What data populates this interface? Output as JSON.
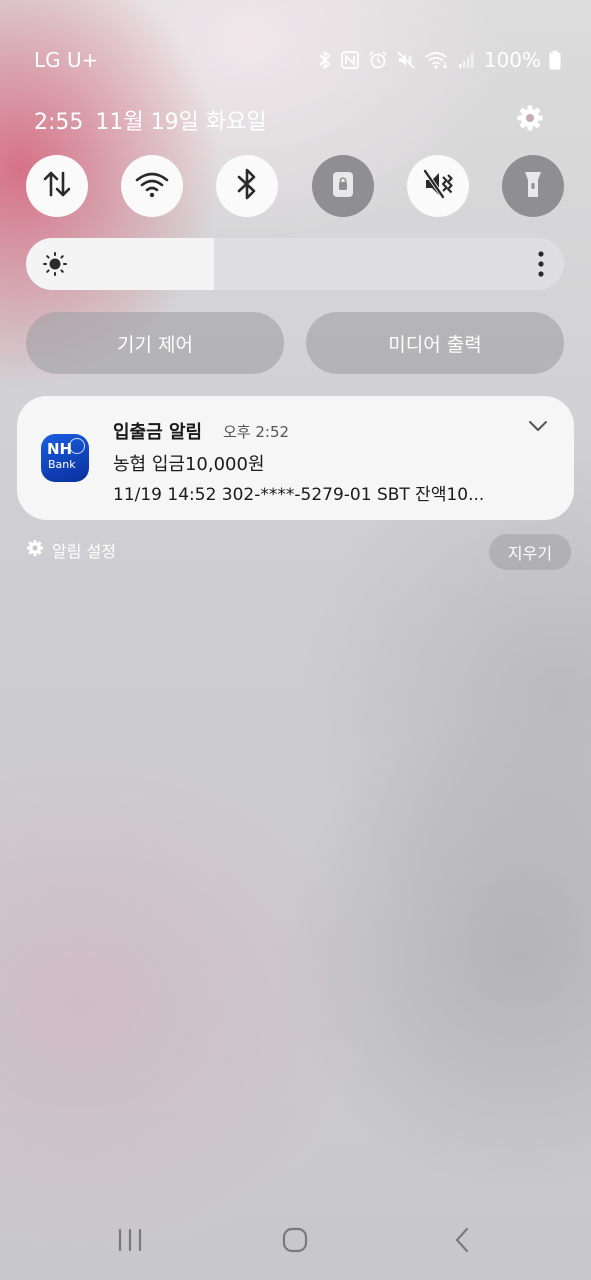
{
  "status_bar": {
    "carrier": "LG U+",
    "battery": "100%",
    "icons": [
      "bluetooth-icon",
      "nfc-icon",
      "alarm-icon",
      "vibrate-mute-icon",
      "wifi-icon",
      "signal-icon",
      "battery-icon"
    ]
  },
  "header": {
    "time": "2:55",
    "date": "11월 19일 화요일",
    "settings_icon": "gear-icon"
  },
  "quick_settings": {
    "tiles": [
      {
        "name": "mobile-data",
        "icon": "data-arrows-icon",
        "active": true
      },
      {
        "name": "wifi",
        "icon": "wifi-icon",
        "active": true
      },
      {
        "name": "bluetooth",
        "icon": "bluetooth-icon",
        "active": true
      },
      {
        "name": "screen-lock",
        "icon": "lock-icon",
        "active": false
      },
      {
        "name": "sound",
        "icon": "vibrate-mute-icon",
        "active": true
      },
      {
        "name": "flashlight",
        "icon": "flashlight-icon",
        "active": false
      }
    ],
    "brightness_level": 0.35
  },
  "buttons": {
    "device_control": "기기 제어",
    "media_output": "미디어 출력"
  },
  "notification": {
    "app_icon_text": "NH",
    "app_icon_subtext": "Bank",
    "title": "입출금 알림",
    "time": "오후 2:52",
    "line1": "농협 입금10,000원",
    "line2": "11/19 14:52 302-****-5279-01 SBT 잔액10..."
  },
  "footer": {
    "notification_settings": "알림 설정",
    "clear": "지우기"
  },
  "colors": {
    "accent_icon": "#2a2a2a",
    "tile_on": "#fafafa",
    "tile_off": "#8f8f92",
    "card_bg": "#f6f6f6",
    "app_icon_blue": "#1a5fe0"
  }
}
